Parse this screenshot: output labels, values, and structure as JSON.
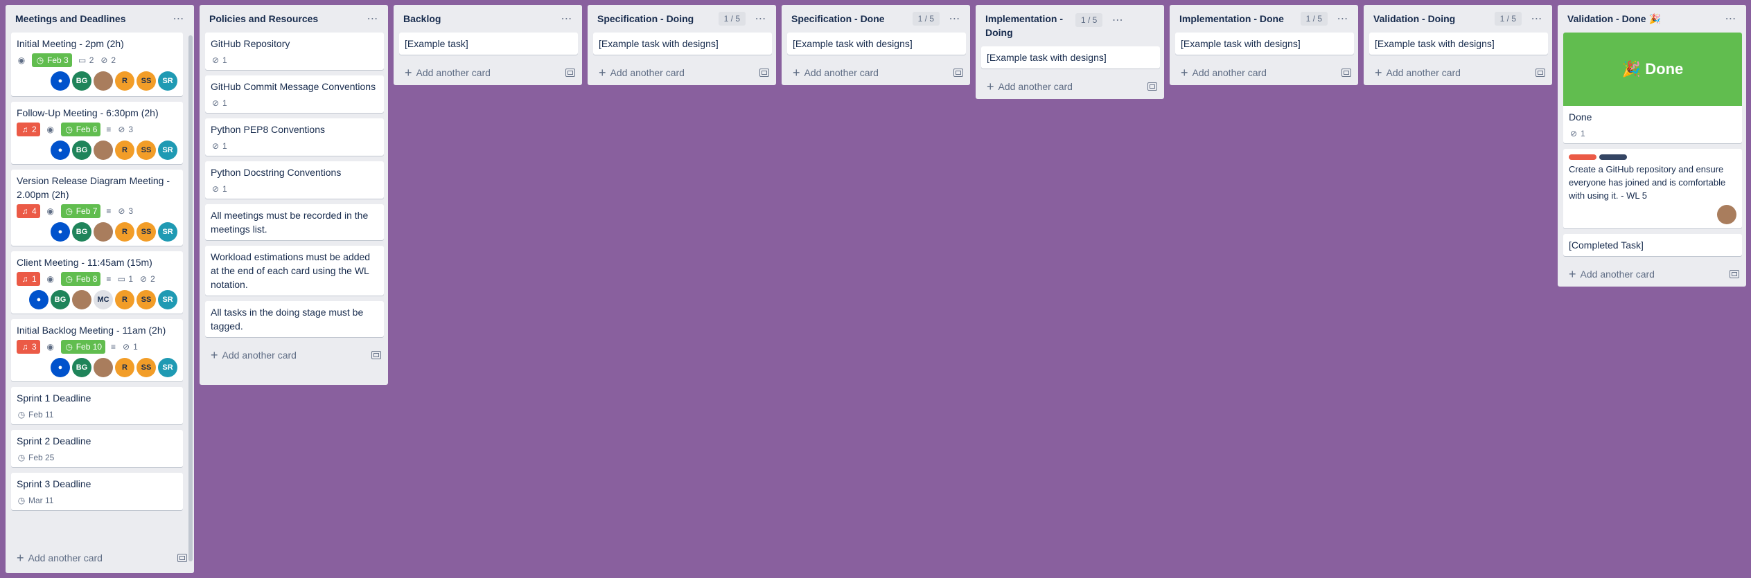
{
  "lists": [
    {
      "title": "Meetings and Deadlines",
      "cards": [
        {
          "title": "Initial Meeting - 2pm (2h)",
          "bell": "",
          "due": "Feb 3",
          "comments": "2",
          "attachments": "2",
          "members": [
            "",
            "BG",
            "",
            "R",
            "SS",
            "SR"
          ]
        },
        {
          "title": "Follow-Up Meeting - 6:30pm (2h)",
          "bell": "2",
          "due": "Feb 6",
          "attachments": "3",
          "members": [
            "",
            "BG",
            "",
            "R",
            "SS",
            "SR"
          ]
        },
        {
          "title": "Version Release Diagram Meeting - 2.00pm (2h)",
          "bell": "4",
          "due": "Feb 7",
          "attachments": "3",
          "members": [
            "",
            "BG",
            "",
            "R",
            "SS",
            "SR"
          ]
        },
        {
          "title": "Client Meeting - 11:45am (15m)",
          "bell": "1",
          "due": "Feb 8",
          "comments": "1",
          "attachments": "2",
          "members": [
            "",
            "BG",
            "",
            "MC",
            "R",
            "SS",
            "SR"
          ]
        },
        {
          "title": "Initial Backlog Meeting - 11am (2h)",
          "bell": "3",
          "due": "Feb 10",
          "attachments": "1",
          "members": [
            "",
            "BG",
            "",
            "R",
            "SS",
            "SR"
          ]
        },
        {
          "title": "Sprint 1 Deadline",
          "date": "Feb 11"
        },
        {
          "title": "Sprint 2 Deadline",
          "date": "Feb 25"
        },
        {
          "title": "Sprint 3 Deadline",
          "date": "Mar 11"
        }
      ],
      "add_label": "Add another card"
    },
    {
      "title": "Policies and Resources",
      "cards": [
        {
          "title": "GitHub Repository",
          "attachments": "1"
        },
        {
          "title": "GitHub Commit Message Conventions",
          "attachments": "1"
        },
        {
          "title": "Python PEP8 Conventions",
          "attachments": "1"
        },
        {
          "title": "Python Docstring Conventions",
          "attachments": "1"
        },
        {
          "title": "All meetings must be recorded in the meetings list."
        },
        {
          "title": "Workload estimations must be added at the end of each card using the WL notation."
        },
        {
          "title": "All tasks in the doing stage must be tagged."
        }
      ],
      "add_label": "Add another card"
    },
    {
      "title": "Backlog",
      "cards": [
        {
          "title": "[Example task]"
        }
      ],
      "add_label": "Add another card"
    },
    {
      "title": "Specification - Doing",
      "wip": "1 / 5",
      "cards": [
        {
          "title": "[Example task with designs]"
        }
      ],
      "add_label": "Add another card"
    },
    {
      "title": "Specification - Done",
      "wip": "1 / 5",
      "cards": [
        {
          "title": "[Example task with designs]"
        }
      ],
      "add_label": "Add another card"
    },
    {
      "title": "Implementation - Doing",
      "wip": "1 / 5",
      "cards": [
        {
          "title": "[Example task with designs]"
        }
      ],
      "add_label": "Add another card"
    },
    {
      "title": "Implementation - Done",
      "wip": "1 / 5",
      "cards": [
        {
          "title": "[Example task with designs]"
        }
      ],
      "add_label": "Add another card"
    },
    {
      "title": "Validation - Doing",
      "wip": "1 / 5",
      "cards": [
        {
          "title": "[Example task with designs]"
        }
      ],
      "add_label": "Add another card"
    },
    {
      "title": "Validation - Done 🎉",
      "cards": [
        {
          "cover_text": "🎉 Done",
          "title": "Done",
          "attachments": "1"
        },
        {
          "title": "Create a GitHub repository and ensure everyone has joined and is comfortable with using it. - WL 5"
        },
        {
          "title": "[Completed Task]"
        }
      ],
      "add_label": "Add another card"
    }
  ],
  "icons": {
    "menu": "⋯",
    "watch": "👁",
    "clock": "🕓",
    "comment": "💬",
    "attachment": "📎",
    "bell": "🔔",
    "description": "≡",
    "plus": "+"
  },
  "colors": {
    "board_bg": "#89609e",
    "list_bg": "#ebecf0",
    "due_green": "#61bd4f",
    "alert_red": "#eb5a46",
    "label_red": "#eb5a46",
    "label_navy": "#344563"
  }
}
